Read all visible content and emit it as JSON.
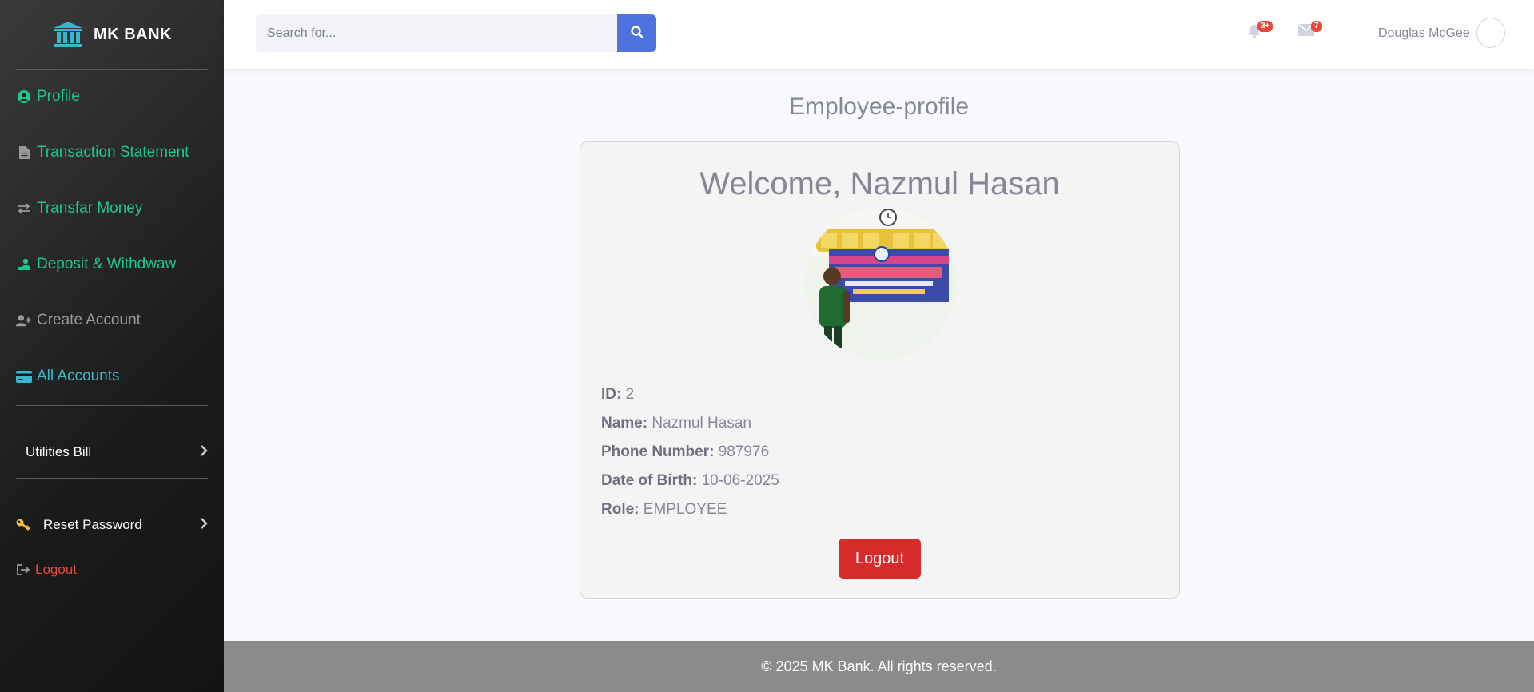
{
  "brand": {
    "name": "MK BANK",
    "icon": "bank-icon"
  },
  "sidebar": {
    "items": [
      {
        "label": "Profile",
        "icon": "user-circle-icon",
        "color": "#1cc88a"
      },
      {
        "label": "Transaction Statement",
        "icon": "file-icon",
        "color": "#1cc88a"
      },
      {
        "label": "Transfar Money",
        "icon": "exchange-icon",
        "color": "#1cc88a"
      },
      {
        "label": "Deposit & Withdwaw",
        "icon": "hand-coin-icon",
        "color": "#1cc88a"
      },
      {
        "label": "Create Account",
        "icon": "user-plus-icon",
        "color": "#9a9a9a"
      },
      {
        "label": "All Accounts",
        "icon": "credit-card-icon",
        "color": "#36b9cc"
      }
    ],
    "utilities": {
      "label": "Utilities Bill"
    },
    "reset_password": {
      "label": "Reset Password",
      "icon": "key-icon"
    },
    "logout": {
      "label": "Logout",
      "icon": "sign-out-icon",
      "color": "#e74a3b"
    }
  },
  "topbar": {
    "search_placeholder": "Search for...",
    "alerts_badge": "3+",
    "messages_badge": "7",
    "user_name": "Douglas McGee"
  },
  "main": {
    "page_title": "Employee-profile",
    "welcome": "Welcome, Nazmul Hasan",
    "fields": [
      {
        "label": "ID:",
        "value": "2"
      },
      {
        "label": "Name:",
        "value": "Nazmul Hasan"
      },
      {
        "label": "Phone Number:",
        "value": "987976"
      },
      {
        "label": "Date of Birth:",
        "value": "10-06-2025"
      },
      {
        "label": "Role:",
        "value": "EMPLOYEE"
      }
    ],
    "logout_button": "Logout"
  },
  "footer": {
    "text": "© 2025 MK Bank. All rights reserved."
  },
  "colors": {
    "primary": "#4e73df",
    "danger": "#d52b2b",
    "success": "#1cc88a",
    "info": "#36b9cc"
  }
}
